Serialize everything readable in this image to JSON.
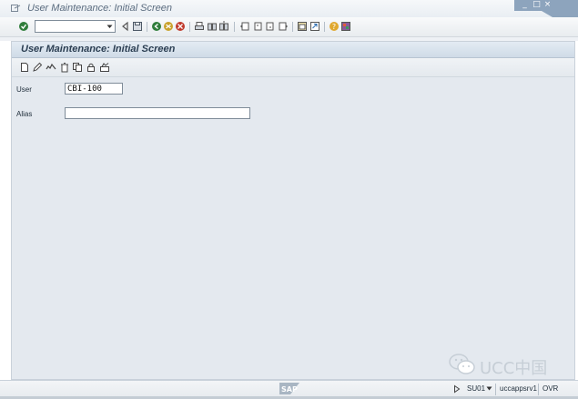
{
  "window": {
    "title": "User Maintenance: Initial Screen",
    "controls": [
      "_",
      "□",
      "×"
    ]
  },
  "toolbar": {
    "command_field_value": "",
    "icons": [
      "enter-icon",
      "back-icon",
      "save-icon",
      "green-back-icon",
      "exit-icon",
      "cancel-icon",
      "print-icon",
      "find-icon",
      "find-next-icon",
      "first-page-icon",
      "previous-page-icon",
      "next-page-icon",
      "last-page-icon",
      "create-session-icon",
      "shortcut-icon",
      "help-icon",
      "customize-layout-icon"
    ]
  },
  "screen": {
    "title": "User Maintenance: Initial Screen",
    "app_icons": [
      "create-icon",
      "change-icon",
      "display-icon",
      "delete-icon",
      "copy-icon",
      "lock-icon",
      "change-password-icon"
    ]
  },
  "form": {
    "user_label": "User",
    "user_value": "CBI-100",
    "alias_label": "Alias",
    "alias_value": ""
  },
  "status": {
    "transaction": "SU01",
    "server": "uccappsrv1",
    "mode": "OVR",
    "logo_text": "SAP"
  },
  "watermark": {
    "text": "UCC中国"
  },
  "colors": {
    "panel_bg": "#e4e9ef",
    "header_bg": "#cfdbe7",
    "title_text": "#5c6d80"
  }
}
